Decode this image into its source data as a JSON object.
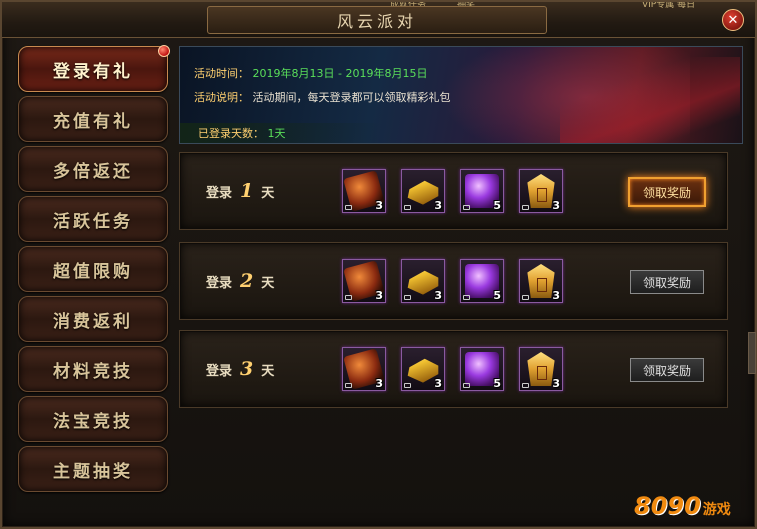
{
  "window": {
    "title": "风云派对",
    "close_glyph": "✕",
    "peek_left": "成就任务",
    "peek_mid": "抽奖",
    "peek_right": "VIP专属 每日"
  },
  "sidebar": {
    "items": [
      {
        "label": "登录有礼",
        "active": true,
        "badge": true
      },
      {
        "label": "充值有礼"
      },
      {
        "label": "多倍返还"
      },
      {
        "label": "活跃任务"
      },
      {
        "label": "超值限购"
      },
      {
        "label": "消费返利"
      },
      {
        "label": "材料竞技"
      },
      {
        "label": "法宝竞技"
      },
      {
        "label": "主题抽奖"
      }
    ]
  },
  "banner": {
    "time_label": "活动时间：",
    "time_value": "2019年8月13日 - 2019年8月15日",
    "desc_label": "活动说明：",
    "desc_value": "活动期间，每天登录都可以领取精彩礼包",
    "days_label": "已登录天数：",
    "days_value": "1天"
  },
  "rows": [
    {
      "prefix": "登录",
      "day": "1",
      "suffix": "天",
      "items": [
        {
          "icon": "ore-icon",
          "count": "3"
        },
        {
          "icon": "gold-bar-icon",
          "count": "3"
        },
        {
          "icon": "purple-orb-icon",
          "count": "5"
        },
        {
          "icon": "gold-tag-icon",
          "count": "3"
        }
      ],
      "button": "领取奖励",
      "highlighted": true
    },
    {
      "prefix": "登录",
      "day": "2",
      "suffix": "天",
      "items": [
        {
          "icon": "ore-icon",
          "count": "3"
        },
        {
          "icon": "gold-bar-icon",
          "count": "3"
        },
        {
          "icon": "purple-orb-icon",
          "count": "5"
        },
        {
          "icon": "gold-tag-icon",
          "count": "3"
        }
      ],
      "button": "领取奖励",
      "highlighted": false
    },
    {
      "prefix": "登录",
      "day": "3",
      "suffix": "天",
      "items": [
        {
          "icon": "ore-icon",
          "count": "3"
        },
        {
          "icon": "gold-bar-icon",
          "count": "3"
        },
        {
          "icon": "purple-orb-icon",
          "count": "5"
        },
        {
          "icon": "gold-tag-icon",
          "count": "3"
        }
      ],
      "button": "领取奖励",
      "highlighted": false
    }
  ],
  "watermark": {
    "number": "8090",
    "text": "游戏"
  },
  "colors": {
    "accent_gold": "#ffd070",
    "value_green": "#5adf5a",
    "frame_brown": "#5a4630",
    "highlight_orange": "#f0a030"
  }
}
